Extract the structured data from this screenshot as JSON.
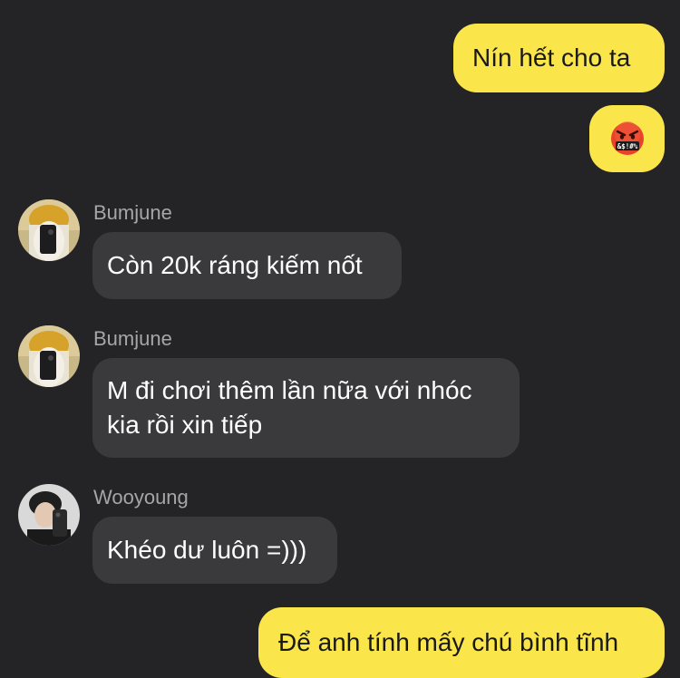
{
  "messages": [
    {
      "direction": "outgoing",
      "text": "Nín hết cho ta"
    },
    {
      "direction": "outgoing",
      "emoji": "🤬",
      "emoji_name": "cursing-face"
    },
    {
      "direction": "incoming",
      "sender": "Bumjune",
      "text": "Còn 20k ráng kiếm nốt"
    },
    {
      "direction": "incoming",
      "sender": "Bumjune",
      "text_lines": [
        "M đi chơi thêm lần nữa với nhóc",
        "kia rồi xin tiếp"
      ]
    },
    {
      "direction": "incoming",
      "sender": "Wooyoung",
      "text": "Khéo dư luôn =)))"
    },
    {
      "direction": "outgoing",
      "text": "Để anh tính mấy chú bình tĩnh"
    }
  ],
  "colors": {
    "background": "#242426",
    "outgoing_bubble": "#fae64b",
    "incoming_bubble": "#3a3a3c",
    "sender_name": "#a6a6a8"
  }
}
